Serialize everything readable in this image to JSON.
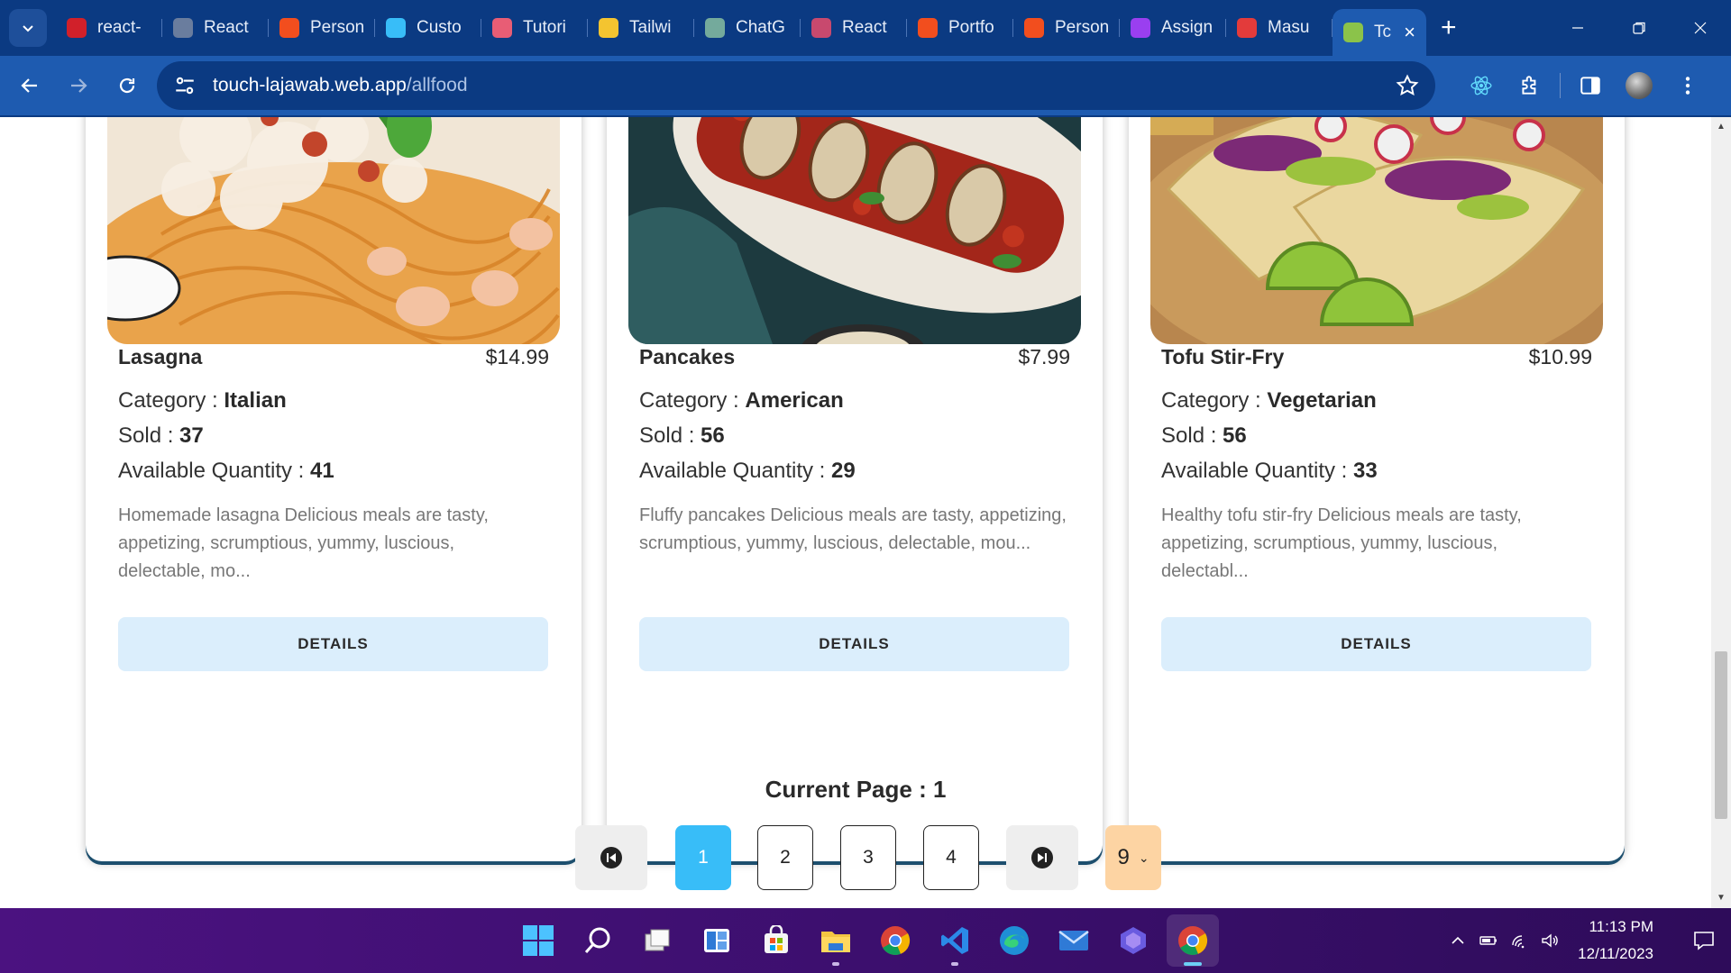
{
  "browser": {
    "tabs": [
      {
        "label": "react-",
        "icon": "react-scripts-red-icon",
        "color": "#d1202a"
      },
      {
        "label": "React",
        "icon": "globe-icon",
        "color": "#6a7d9e"
      },
      {
        "label": "Person",
        "icon": "figma-icon",
        "color": "#f24e1e"
      },
      {
        "label": "Custo",
        "icon": "tailwind-icon",
        "color": "#38bdf8"
      },
      {
        "label": "Tutori",
        "icon": "tutorial-dots-icon",
        "color": "#e85d75"
      },
      {
        "label": "Tailwi",
        "icon": "tailwind-person-icon",
        "color": "#f4c430"
      },
      {
        "label": "ChatG",
        "icon": "chatgpt-icon",
        "color": "#74aa9c"
      },
      {
        "label": "React",
        "icon": "react-atom-icon",
        "color": "#c8496e"
      },
      {
        "label": "Portfo",
        "icon": "figma-icon",
        "color": "#f24e1e"
      },
      {
        "label": "Person",
        "icon": "figma-icon",
        "color": "#f24e1e"
      },
      {
        "label": "Assign",
        "icon": "assignment-play-icon",
        "color": "#9a3ff0"
      },
      {
        "label": "Masu",
        "icon": "masu-logo-icon",
        "color": "#e33b3b"
      },
      {
        "label": "Tc",
        "icon": "touch-lajawab-icon",
        "color": "#8bc34a",
        "active": true
      }
    ],
    "new_tab": "+",
    "url_host": "touch-lajawab.web.app",
    "url_path": "/allfood"
  },
  "foods": [
    {
      "name": "Lasagna",
      "price": "$14.99",
      "category_label": "Category : ",
      "category": "Italian",
      "sold_label": "Sold : ",
      "sold": "37",
      "qty_label": "Available Quantity : ",
      "qty": "41",
      "description": "Homemade lasagna Delicious meals are tasty, appetizing, scrumptious, yummy, luscious, delectable, mo...",
      "button": "DETAILS"
    },
    {
      "name": "Pancakes",
      "price": "$7.99",
      "category_label": "Category : ",
      "category": "American",
      "sold_label": "Sold : ",
      "sold": "56",
      "qty_label": "Available Quantity : ",
      "qty": "29",
      "description": "Fluffy pancakes Delicious meals are tasty, appetizing, scrumptious, yummy, luscious, delectable, mou...",
      "button": "DETAILS"
    },
    {
      "name": "Tofu Stir-Fry",
      "price": "$10.99",
      "category_label": "Category : ",
      "category": "Vegetarian",
      "sold_label": "Sold : ",
      "sold": "56",
      "qty_label": "Available Quantity : ",
      "qty": "33",
      "description": "Healthy tofu stir-fry Delicious meals are tasty, appetizing, scrumptious, yummy, luscious, delectabl...",
      "button": "DETAILS"
    }
  ],
  "pagination": {
    "current_label": "Current Page : 1",
    "pages": [
      "1",
      "2",
      "3",
      "4"
    ],
    "active_page": "1",
    "per_page": "9",
    "accent": "#38bdf8",
    "select_color": "#fdd4a3"
  },
  "taskbar": {
    "apps": [
      "windows-start-icon",
      "search-icon",
      "task-view-icon",
      "widgets-icon",
      "store-icon",
      "file-explorer-icon",
      "chrome-icon",
      "vscode-icon",
      "edge-icon",
      "mail-icon",
      "copilot-icon",
      "chrome-active-icon"
    ],
    "time": "11:13 PM",
    "date": "12/11/2023"
  }
}
